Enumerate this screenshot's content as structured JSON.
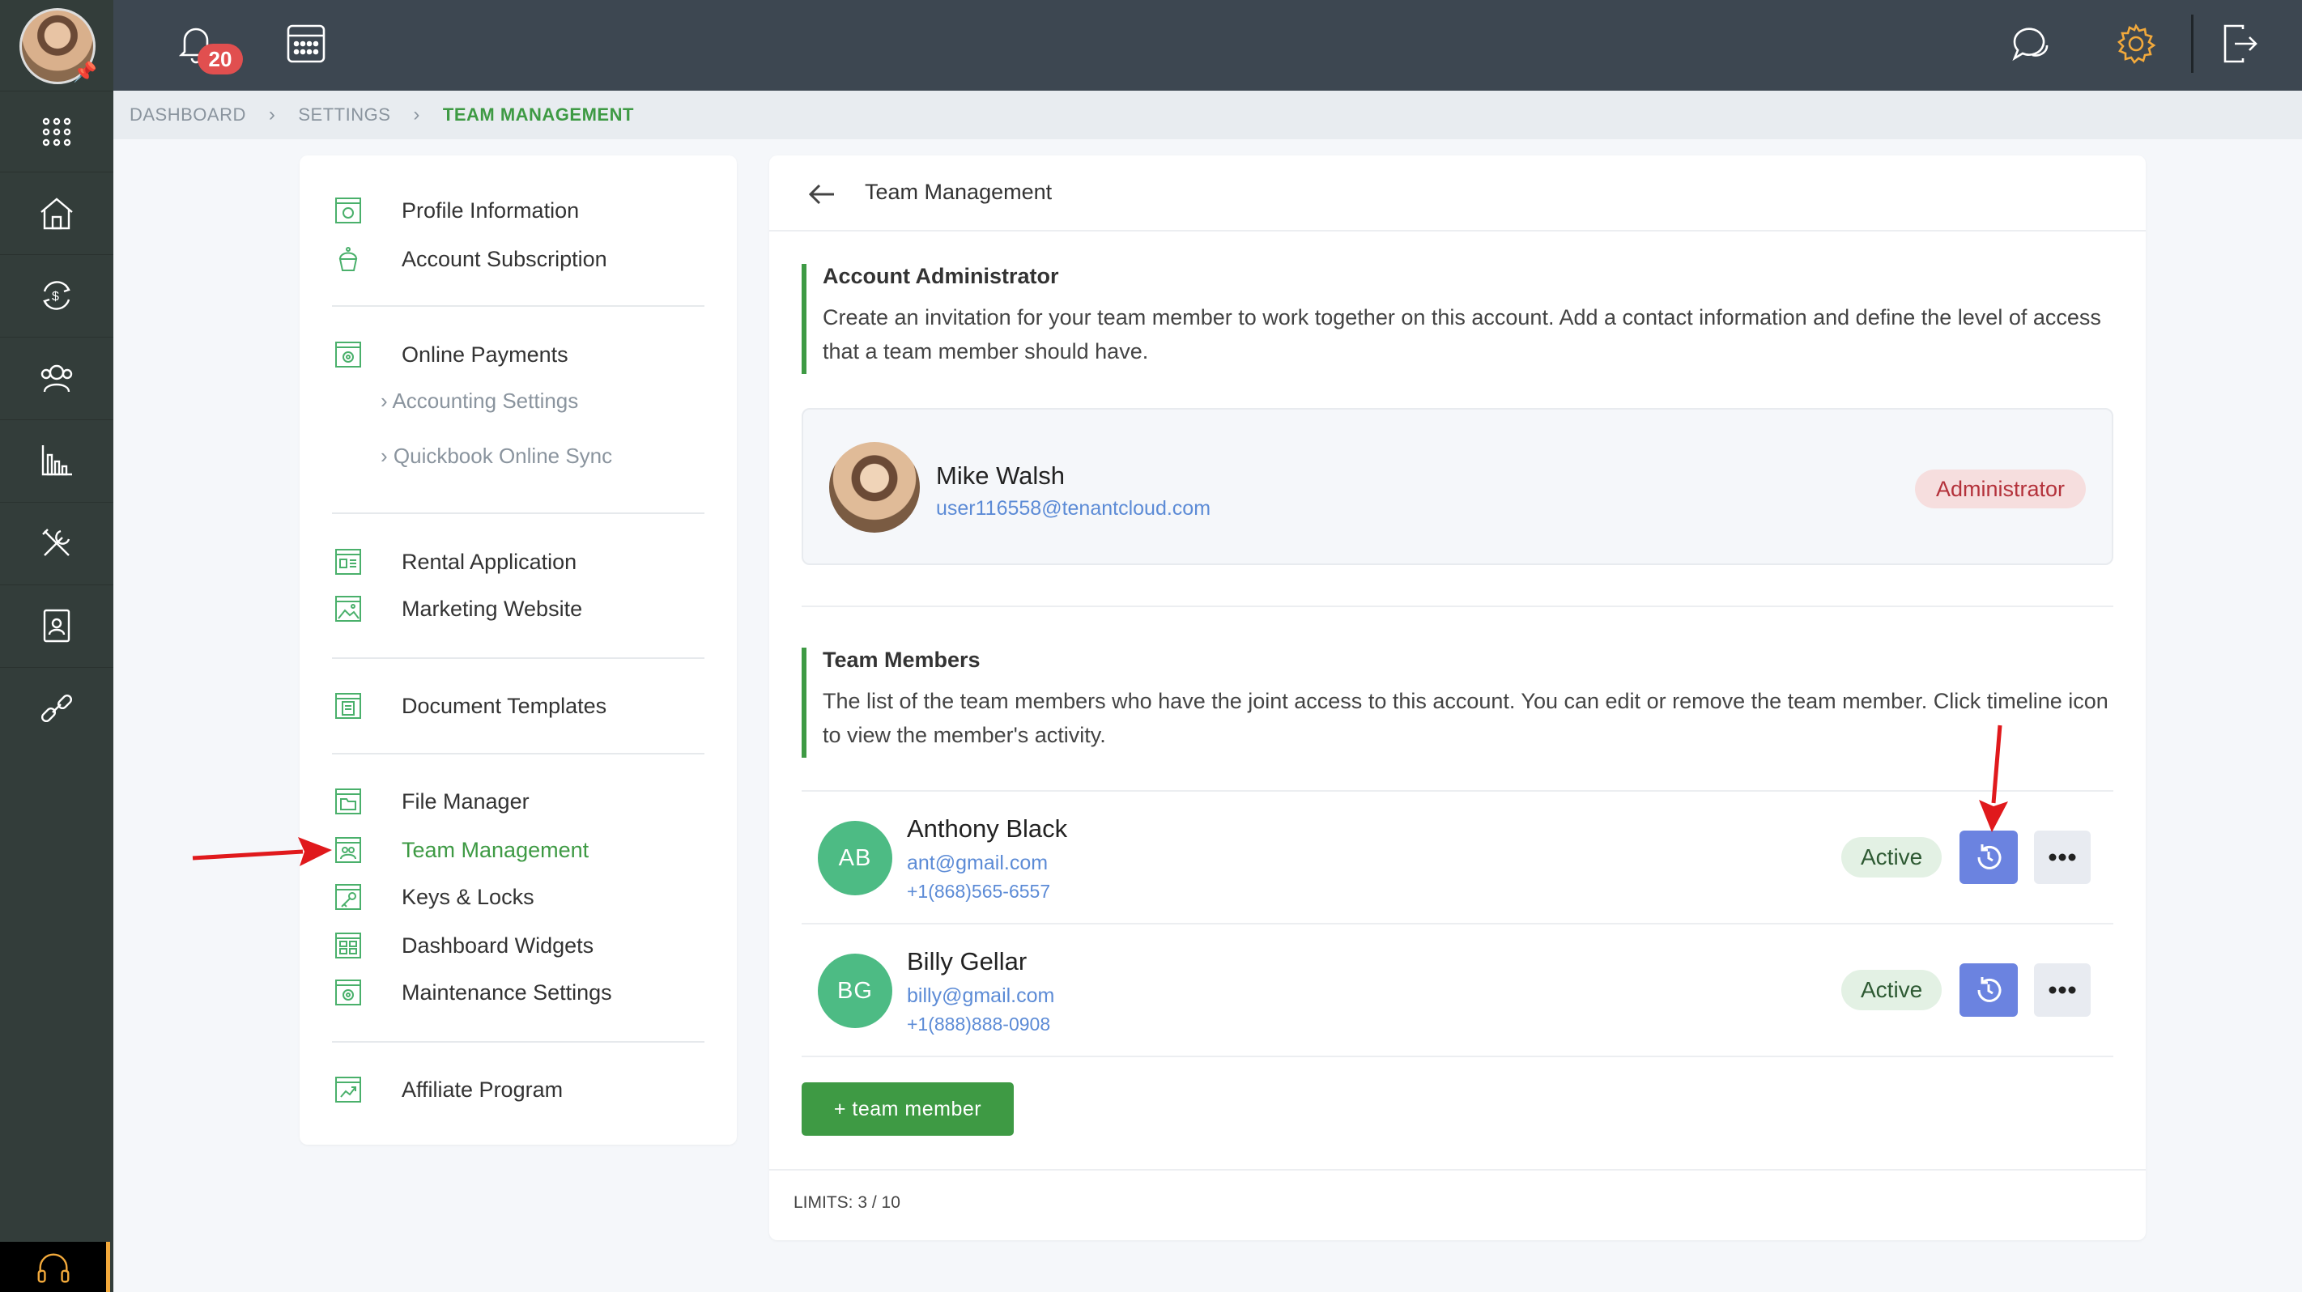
{
  "topbar": {
    "notifications_count": "20",
    "icons": [
      "bell-icon",
      "calendar-icon",
      "chat-icon",
      "gear-icon",
      "logout-icon"
    ],
    "accent_color": "#f2a93b"
  },
  "leftnav": {
    "items": [
      "apps-grid-icon",
      "properties-icon",
      "payments-icon",
      "contacts-icon",
      "reports-icon",
      "maintenance-icon",
      "documents-icon",
      "integrations-icon"
    ],
    "support_icon": "headset-icon"
  },
  "breadcrumb": {
    "items": [
      "DASHBOARD",
      "SETTINGS",
      "TEAM MANAGEMENT"
    ]
  },
  "settings_menu": {
    "items": [
      {
        "label": "Profile Information",
        "icon": "profile-icon"
      },
      {
        "label": "Account Subscription",
        "icon": "cupcake-icon"
      },
      {
        "label": "Online Payments",
        "icon": "payments-icon"
      },
      {
        "label": "Rental Application",
        "icon": "application-icon"
      },
      {
        "label": "Marketing Website",
        "icon": "image-icon"
      },
      {
        "label": "Document Templates",
        "icon": "document-icon"
      },
      {
        "label": "File Manager",
        "icon": "folder-icon"
      },
      {
        "label": "Team Management",
        "icon": "team-icon"
      },
      {
        "label": "Keys & Locks",
        "icon": "key-icon"
      },
      {
        "label": "Dashboard Widgets",
        "icon": "widgets-icon"
      },
      {
        "label": "Maintenance Settings",
        "icon": "maintenance-icon"
      },
      {
        "label": "Affiliate Program",
        "icon": "affiliate-icon"
      }
    ],
    "subitems": [
      "Accounting Settings",
      "Quickbook Online Sync"
    ],
    "active": "Team Management"
  },
  "main": {
    "title": "Team Management",
    "admin_section": {
      "title": "Account Administrator",
      "description": "Create an invitation for your team member to work together on this account. Add a contact information and define the level of access that a team member should have."
    },
    "admin": {
      "name": "Mike Walsh",
      "email": "user116558@tenantcloud.com",
      "role": "Administrator"
    },
    "members_section": {
      "title": "Team Members",
      "description": "The list of the team members who have the joint access to this account. You can edit or remove the team member. Click timeline icon to view the member's activity."
    },
    "members": [
      {
        "initials": "AB",
        "name": "Anthony Black",
        "email": "ant@gmail.com",
        "phone": "+1(868)565-6557",
        "status": "Active"
      },
      {
        "initials": "BG",
        "name": "Billy Gellar",
        "email": "billy@gmail.com",
        "phone": "+1(888)888-0908",
        "status": "Active"
      }
    ],
    "add_button": "+ team member",
    "limits": "LIMITS: 3 / 10"
  }
}
